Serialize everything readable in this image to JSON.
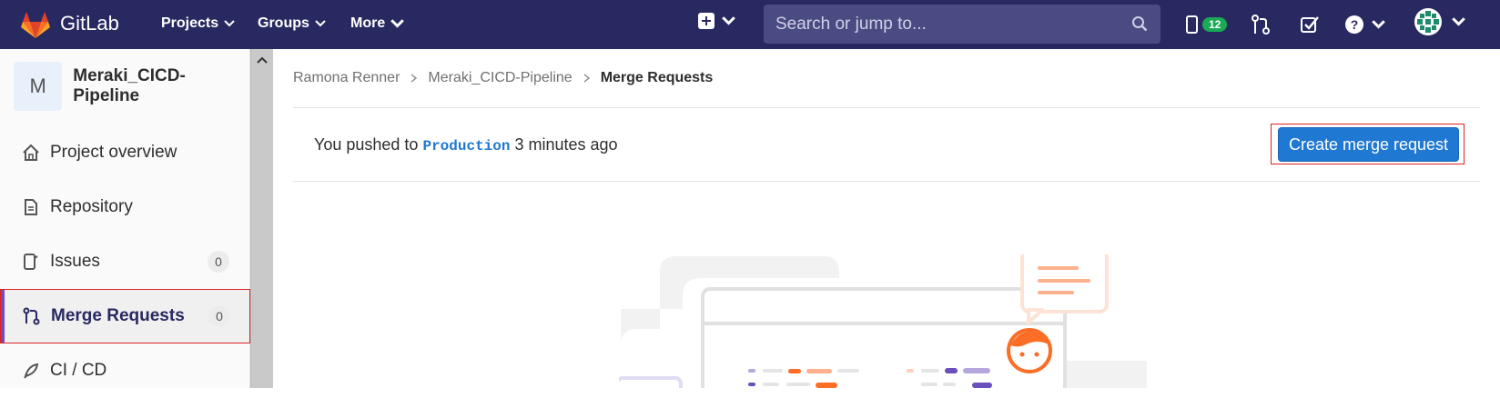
{
  "navbar": {
    "brand": "GitLab",
    "menus": [
      {
        "label": "Projects"
      },
      {
        "label": "Groups"
      },
      {
        "label": "More"
      }
    ],
    "search": {
      "placeholder": "Search or jump to..."
    },
    "issues_badge": "12",
    "colors": {
      "bg": "#292961",
      "search_bg": "#4b4b83",
      "badge": "#1aaa55"
    }
  },
  "sidebar": {
    "project_avatar_letter": "M",
    "project_name": "Meraki_CICD-Pipeline",
    "items": [
      {
        "label": "Project overview",
        "icon": "home-icon"
      },
      {
        "label": "Repository",
        "icon": "document-icon"
      },
      {
        "label": "Issues",
        "icon": "issues-icon",
        "count": "0"
      },
      {
        "label": "Merge Requests",
        "icon": "merge-request-icon",
        "count": "0",
        "active": true
      },
      {
        "label": "CI / CD",
        "icon": "rocket-icon"
      }
    ]
  },
  "breadcrumb": {
    "items": [
      "Ramona Renner",
      "Meraki_CICD-Pipeline",
      "Merge Requests"
    ]
  },
  "push_notice": {
    "prefix": "You pushed to",
    "branch": "Production",
    "suffix": "3 minutes ago",
    "button_label": "Create merge request"
  },
  "colors": {
    "accent": "#1f78d1",
    "highlight_outline": "#dd2222",
    "active_indicator": "#6b4fbb"
  }
}
